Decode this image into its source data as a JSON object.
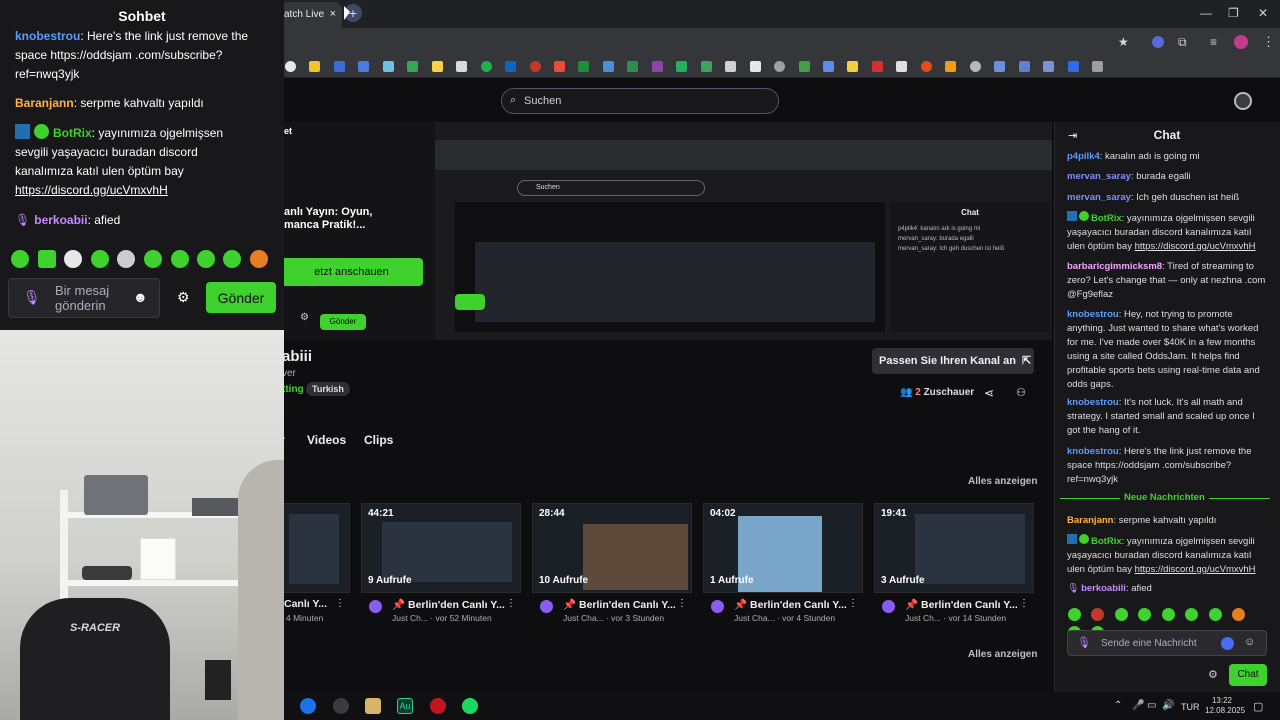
{
  "browser": {
    "tab_label": "atch Live",
    "tab_close": "×",
    "new_tab": "+",
    "win_min": "—",
    "win_max": "❐",
    "win_close": "✕"
  },
  "twitch": {
    "search_placeholder": "Suchen",
    "stream_overlay_title": "anlı Yayın: Oyun,",
    "stream_overlay_title2": "manca Pratik!...",
    "watch_button": "etzt anschauen",
    "nested_send": "Gönder",
    "channel_name": "abiii",
    "channel_sub": "ver",
    "category": "tting",
    "tag": "Turkish",
    "manage_button": "Passen Sie Ihren Kanal an",
    "viewers_count": "2",
    "viewers_label": "Zuschauer",
    "nav_partial": "r",
    "nav_videos": "Videos",
    "nav_clips": "Clips",
    "show_all_1": "Alles anzeigen",
    "show_all_2": "Alles anzeigen",
    "videos": [
      {
        "duration": "",
        "views": "",
        "title": "Canlı Y...",
        "meta": "4 Minuten"
      },
      {
        "duration": "44:21",
        "views": "9 Aufrufe",
        "title": "Berlin'den Canlı Y...",
        "meta": "Just Ch... · vor 52 Minuten"
      },
      {
        "duration": "28:44",
        "views": "10 Aufrufe",
        "title": "Berlin'den Canlı Y...",
        "meta": "Just Cha... · vor 3 Stunden"
      },
      {
        "duration": "04:02",
        "views": "1 Aufrufe",
        "title": "Berlin'den Canlı Y...",
        "meta": "Just Cha... · vor 4 Stunden"
      },
      {
        "duration": "19:41",
        "views": "3 Aufrufe",
        "title": "Berlin'den Canlı Y...",
        "meta": "Just Ch... · vor 14 Stunden"
      }
    ]
  },
  "chat": {
    "title": "Chat",
    "messages": [
      {
        "user": "p4pilk4",
        "text": ": kanalın adı is going mi",
        "color": "#5b9bff"
      },
      {
        "user": "mervan_saray",
        "text": ": burada egalli",
        "color": "#7c8dff"
      },
      {
        "user": "mervan_saray",
        "text": ": Ich geh duschen ist heiß",
        "color": "#7c8dff"
      },
      {
        "user": "BotRix",
        "text": ": yayınımıza ojgelmişsen sevgili yaşayacıcı buradan discord kanalımıza katıl ulen öptüm bay ",
        "link": "https://discord.gg/ucVmxvhH",
        "color": "#3fd12e"
      },
      {
        "user": "barbaricgimmicksm8",
        "text": ": Tired of streaming to zero? Let's change that — only at nezhna .com @Fg9eflaz",
        "color": "#f5a3ff"
      },
      {
        "user": "knobestrou",
        "text": ": Hey, not trying to promote anything. Just wanted to share what's worked for me. I've made over $40K in a few months using a site called OddsJam. It helps find profitable sports bets using real-time data and odds gaps.",
        "color": "#5b9bff"
      },
      {
        "user": "knobestrou",
        "text": ": It's not luck. It's all math and strategy. I started small and scaled up once I got the hang of it.",
        "color": "#5b9bff"
      },
      {
        "user": "knobestrou",
        "text": ": Here's the link just remove the space https://oddsjam .com/subscribe?ref=nwq3yjk",
        "color": "#5b9bff"
      }
    ],
    "new_messages": "Neue Nachrichten",
    "messages_after": [
      {
        "user": "Baranjann",
        "text": ": serpme kahvaltı yapıldı",
        "color": "#ffb347"
      },
      {
        "user": "BotRix",
        "text": ": yayınımıza ojgelmişsen sevgili yaşayacıcı buradan discord kanalımıza katıl ulen öptüm bay ",
        "link": "https://discord.gg/ucVmxvhH",
        "color": "#3fd12e"
      },
      {
        "user": "berkoabili",
        "text": ": afied",
        "color": "#c58bff"
      }
    ],
    "input_placeholder": "Sende eine Nachricht",
    "send_button": "Chat"
  },
  "nested": {
    "chat_title": "Chat",
    "search": "Suchen"
  },
  "overlay": {
    "title": "Sohbet",
    "msg1_user": "knobestrou",
    "msg1_text": ": Here's the link just remove the space https://oddsjam .com/subscribe?ref=nwq3yjk",
    "msg2_user": "Baranjann",
    "msg2_text": ": serpme kahvaltı yapıldı",
    "msg3_user": "BotRix",
    "msg3_text": ": yayınımıza ojgelmişsen sevgili yaşayacıcı buradan discord kanalımıza katıl ulen öptüm bay",
    "msg3_link": "https://discord.gg/ucVmxvhH",
    "msg4_user": "berkoabii",
    "msg4_text": ": afied",
    "input_placeholder": "Bir mesaj gönderin",
    "send_button": "Gönder"
  },
  "webcam": {
    "chair_brand": "S-RACER"
  },
  "taskbar": {
    "lang": "TUR",
    "time": "13:22",
    "date": "12.08.2025"
  },
  "colors": {
    "twitch_green": "#3fd12e",
    "bg": "#0e0e10",
    "panel": "#18181b"
  }
}
